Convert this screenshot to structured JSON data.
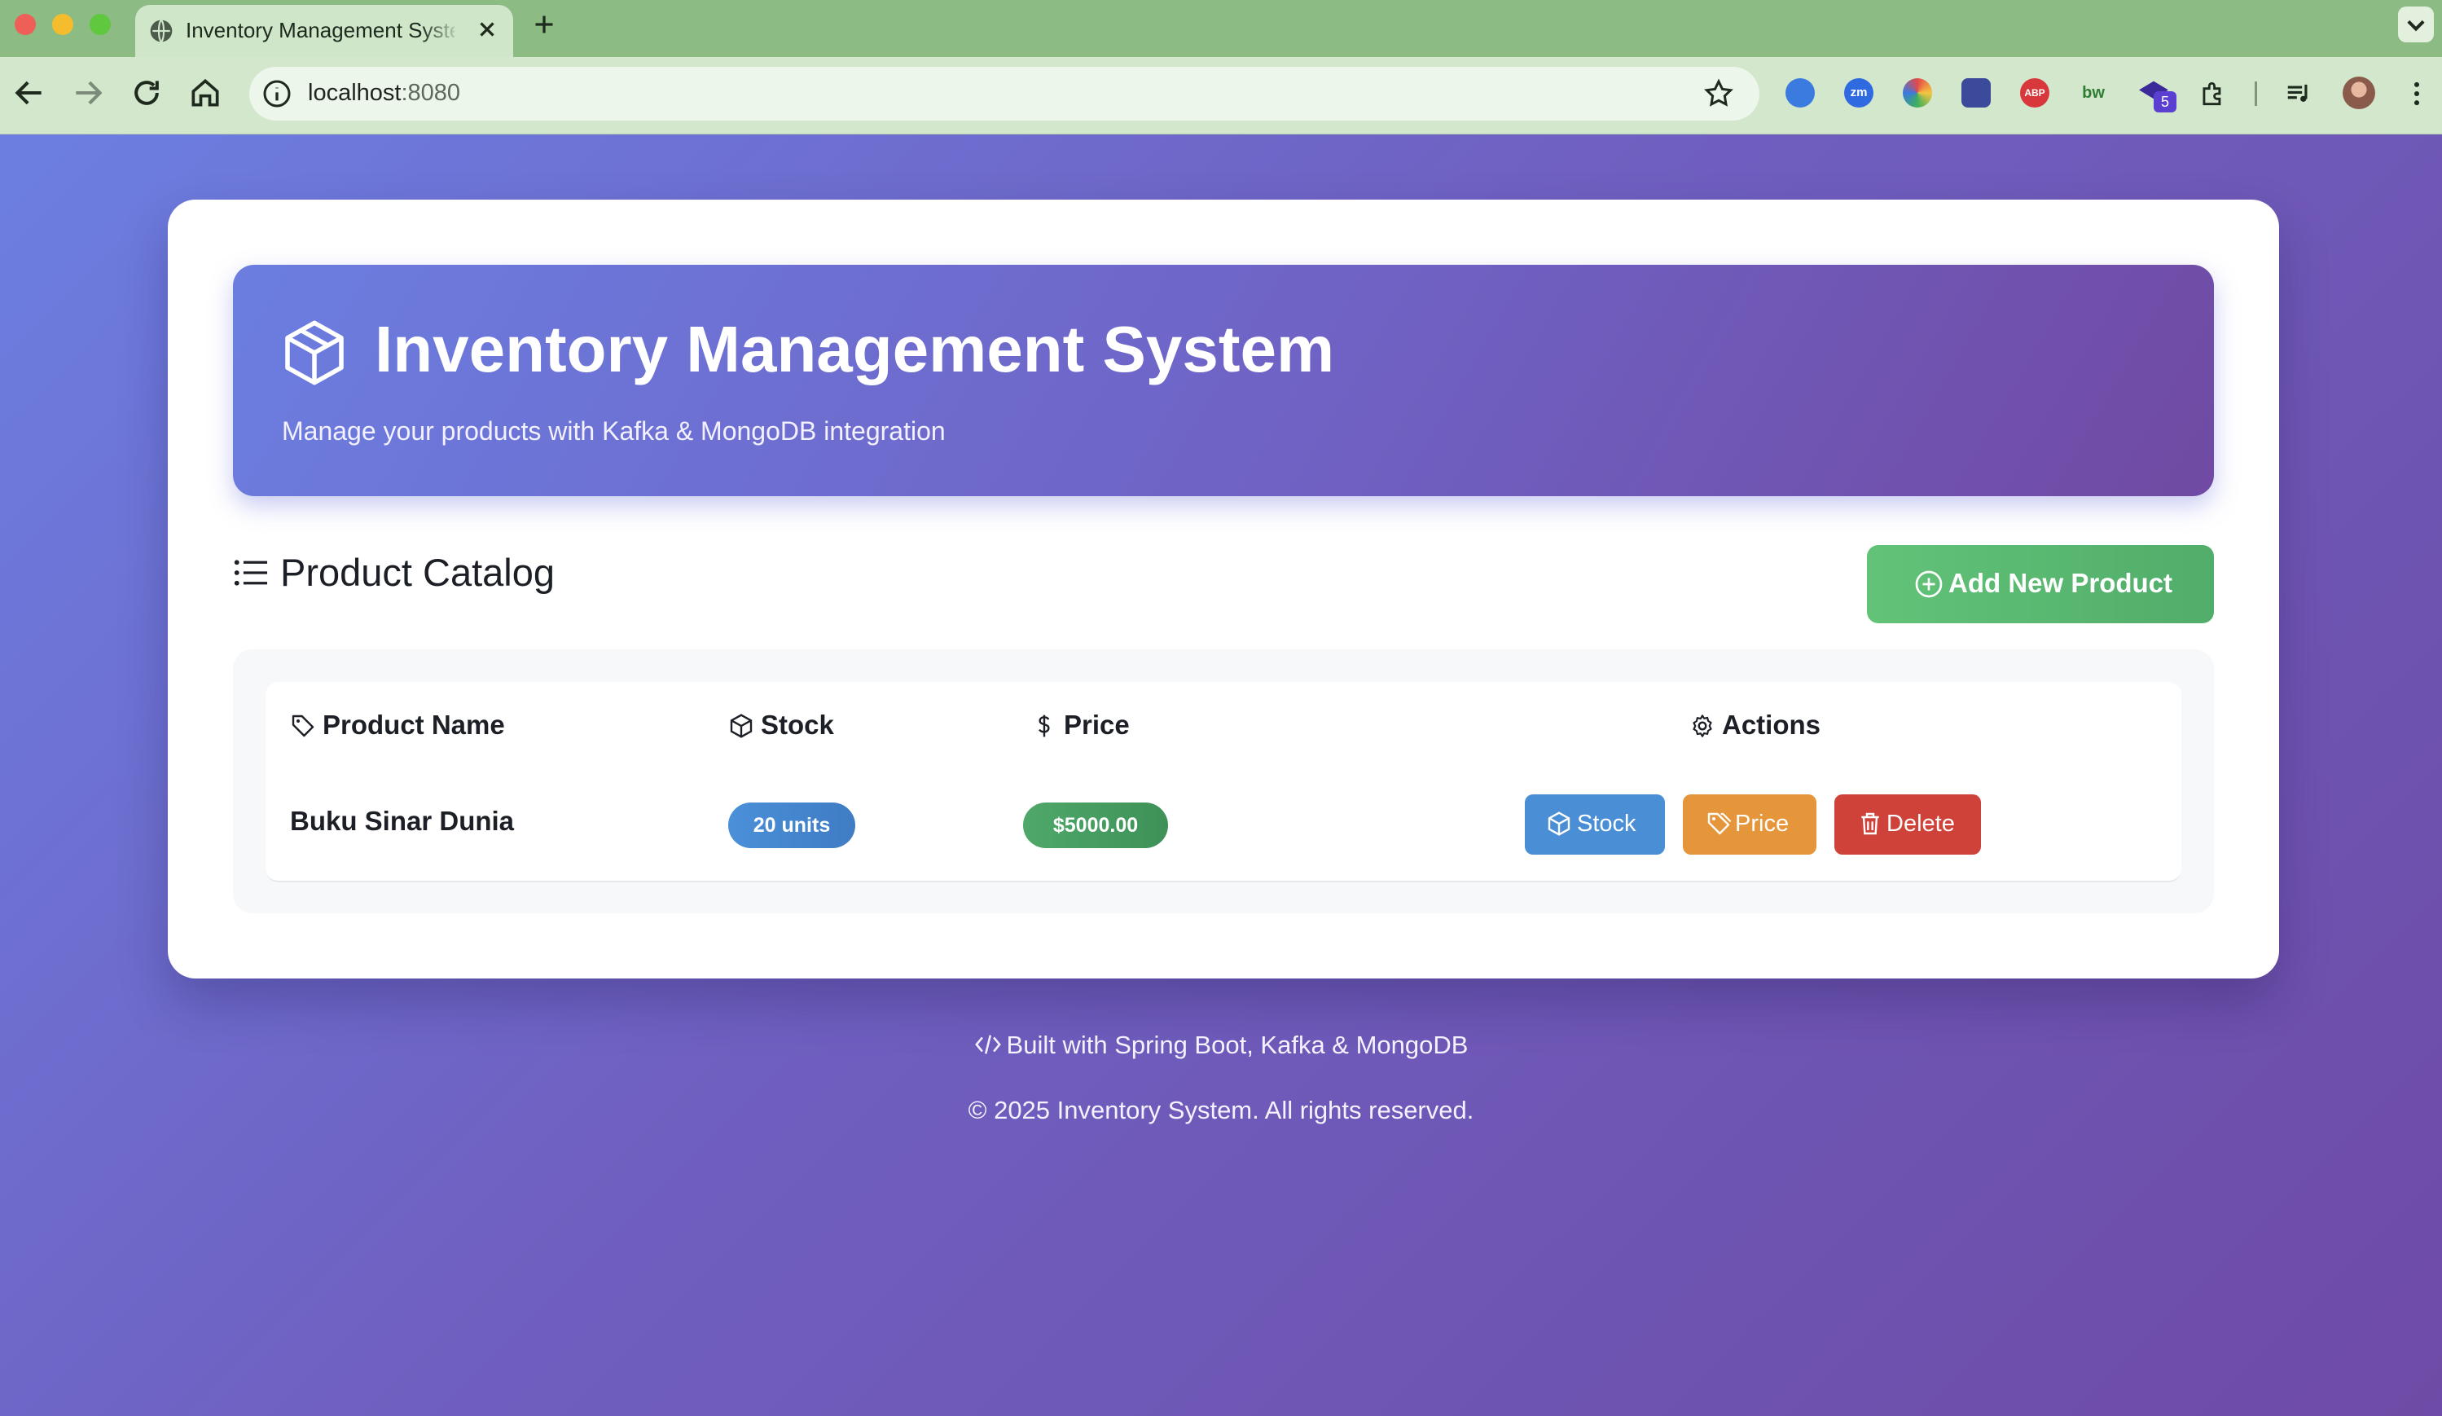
{
  "browser": {
    "tab_title": "Inventory Management System",
    "url_host": "localhost",
    "url_port": ":8080",
    "extensions": [
      {
        "name": "sync-icon",
        "color": "#3b7be0",
        "text": ""
      },
      {
        "name": "zoom-extension-icon",
        "color": "#2f6ae0",
        "text": "zm"
      },
      {
        "name": "chrome-color-extension-icon",
        "color": "#e34a4a",
        "text": ""
      },
      {
        "name": "mascot-extension-icon",
        "color": "#3b4a9a",
        "text": ""
      },
      {
        "name": "adblock-plus-icon",
        "color": "#d8383b",
        "text": "ABP"
      },
      {
        "name": "bw-extension-icon",
        "color": "#2f7d32",
        "text": "bw"
      },
      {
        "name": "graduation-cap-extension-icon",
        "color": "#3a2a9a",
        "text": ""
      }
    ],
    "extension_badge": "5"
  },
  "hero": {
    "title": "Inventory Management System",
    "subtitle": "Manage your products with Kafka & MongoDB integration",
    "icon": "package-icon"
  },
  "catalog": {
    "heading": "Product Catalog",
    "add_button": "Add New Product",
    "columns": {
      "name": "Product Name",
      "stock": "Stock",
      "price": "Price",
      "actions": "Actions"
    },
    "rows": [
      {
        "name": "Buku Sinar Dunia",
        "stock": "20 units",
        "price": "$5000.00",
        "actions": {
          "stock": "Stock",
          "price": "Price",
          "delete": "Delete"
        }
      }
    ]
  },
  "footer": {
    "built_with": "Built with Spring Boot, Kafka & MongoDB",
    "copyright": "© 2025 Inventory System. All rights reserved."
  },
  "colors": {
    "success": "#5cb872",
    "info": "#4a8fd6",
    "warning": "#e5953a",
    "danger": "#cf4239",
    "primary_gradient_start": "#6b7ee0",
    "primary_gradient_end": "#704aa3"
  }
}
